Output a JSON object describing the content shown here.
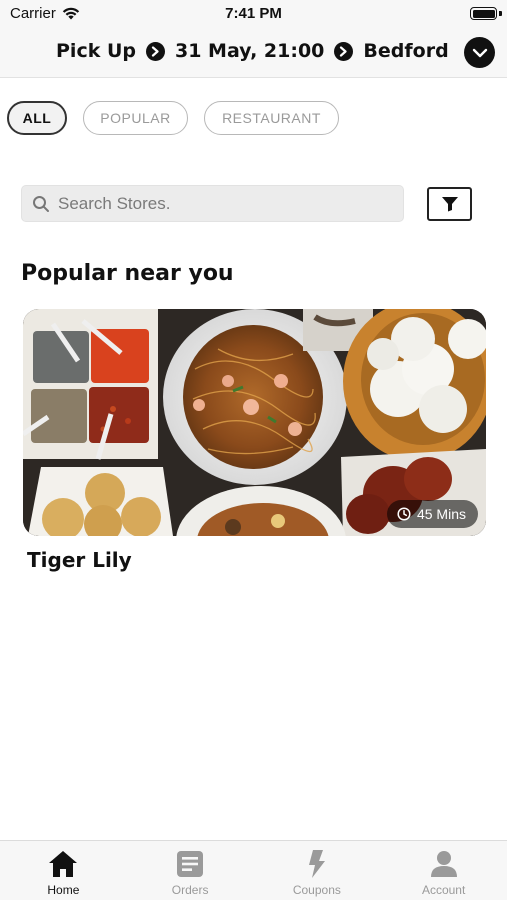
{
  "status_bar": {
    "carrier": "Carrier",
    "time": "7:41 PM"
  },
  "header": {
    "mode": "Pick Up",
    "datetime": "31 May, 21:00",
    "location": "Bedford"
  },
  "filters": [
    {
      "label": "ALL",
      "active": true
    },
    {
      "label": "POPULAR",
      "active": false
    },
    {
      "label": "RESTAURANT",
      "active": false
    }
  ],
  "search": {
    "placeholder": "Search Stores."
  },
  "section": {
    "title": "Popular near you"
  },
  "stores": [
    {
      "name": "Tiger Lily",
      "eta": "45 Mins"
    }
  ],
  "tabbar": [
    {
      "label": "Home",
      "icon": "home-icon",
      "active": true
    },
    {
      "label": "Orders",
      "icon": "orders-icon",
      "active": false
    },
    {
      "label": "Coupons",
      "icon": "coupons-icon",
      "active": false
    },
    {
      "label": "Account",
      "icon": "account-icon",
      "active": false
    }
  ],
  "colors": {
    "primary": "#111111",
    "inactive": "#9a9a9a",
    "chip_border": "#b8b8b8",
    "background": "#ffffff",
    "bar": "#f7f7f7"
  }
}
